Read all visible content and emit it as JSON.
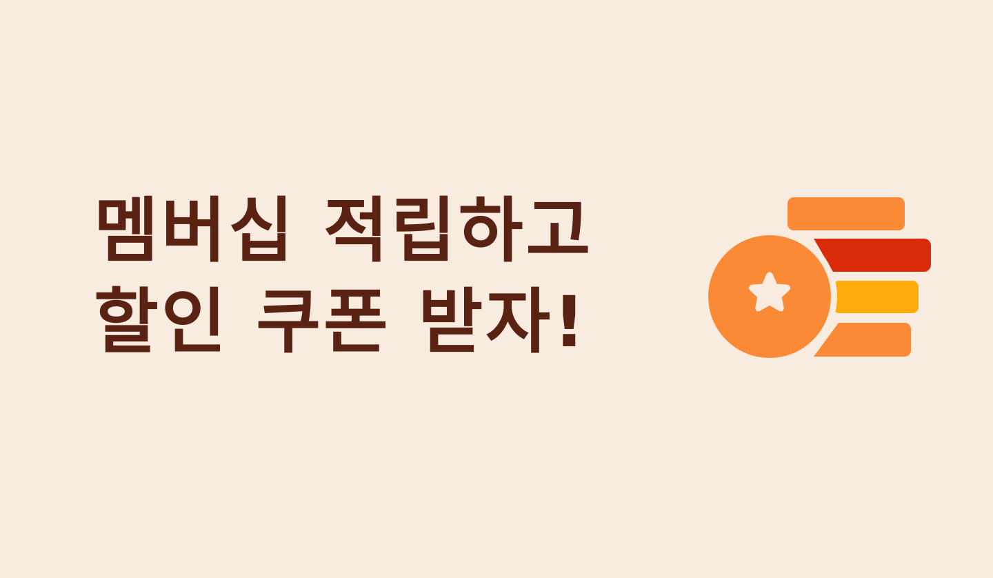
{
  "banner": {
    "headline_line1": "멤버십 적립하고",
    "headline_line2": "할인 쿠폰 받자!"
  },
  "emblem": {
    "icon": "star-coin-stack-icon",
    "colors": {
      "background": "#f7ecdf",
      "text": "#5a2212",
      "coin": "#fb8a37",
      "bar_orange": "#fb8a37",
      "bar_red": "#d92a0a",
      "bar_yellow": "#fdac0c",
      "star": "#f7ecdf"
    }
  }
}
